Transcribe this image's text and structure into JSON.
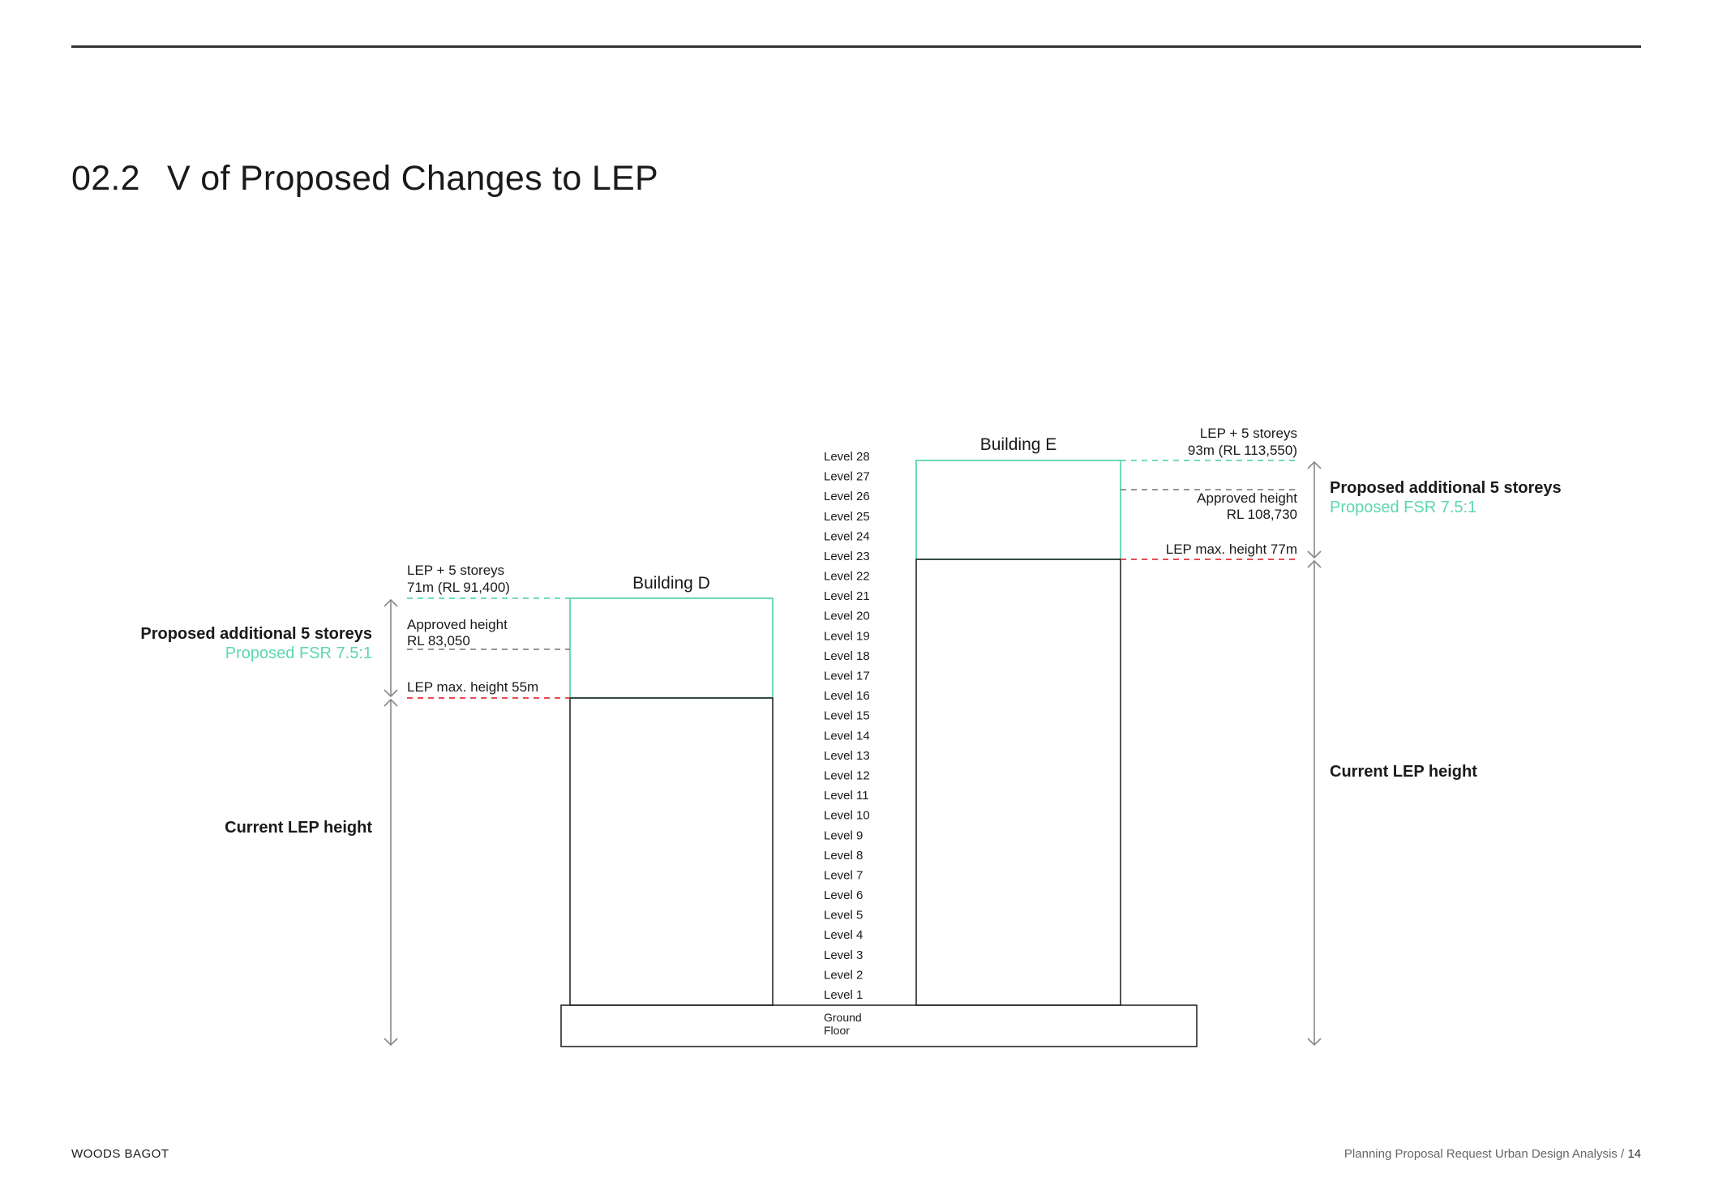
{
  "header": {
    "section_number": "02.2",
    "title": "V of Proposed Changes to LEP"
  },
  "colors": {
    "proposed": "#5dd6b0",
    "approved": "#888888",
    "lep_limit": "#e8323a",
    "outline": "#1a1a1a",
    "arrow": "#888888"
  },
  "levels": [
    "Level 28",
    "Level 27",
    "Level 26",
    "Level 25",
    "Level 24",
    "Level 23",
    "Level 22",
    "Level 21",
    "Level 20",
    "Level 19",
    "Level 18",
    "Level 17",
    "Level 16",
    "Level 15",
    "Level 14",
    "Level 13",
    "Level 12",
    "Level 11",
    "Level 10",
    "Level 9",
    "Level 8",
    "Level 7",
    "Level 6",
    "Level 5",
    "Level 4",
    "Level 3",
    "Level 2",
    "Level 1"
  ],
  "podium": {
    "label_line1": "Ground",
    "label_line2": "Floor"
  },
  "building_d": {
    "name": "Building D",
    "lep_plus_line1": "LEP + 5 storeys",
    "lep_plus_line2": "71m (RL 91,400)",
    "approved_line1": "Approved height",
    "approved_line2": "RL 83,050",
    "lep_max": "LEP max. height 55m",
    "proposed_label": "Proposed additional 5 storeys",
    "proposed_fsr": "Proposed FSR 7.5:1",
    "current_label": "Current LEP height"
  },
  "building_e": {
    "name": "Building E",
    "lep_plus_line1": "LEP + 5 storeys",
    "lep_plus_line2": "93m (RL 113,550)",
    "approved_line1": "Approved height",
    "approved_line2": "RL 108,730",
    "lep_max": "LEP max. height 77m",
    "proposed_label": "Proposed additional 5 storeys",
    "proposed_fsr": "Proposed FSR 7.5:1",
    "current_label": "Current LEP height"
  },
  "footer": {
    "company": "WOODS BAGOT",
    "document": "Planning Proposal Request Urban Design Analysis",
    "separator": "/",
    "page_number": "14"
  }
}
